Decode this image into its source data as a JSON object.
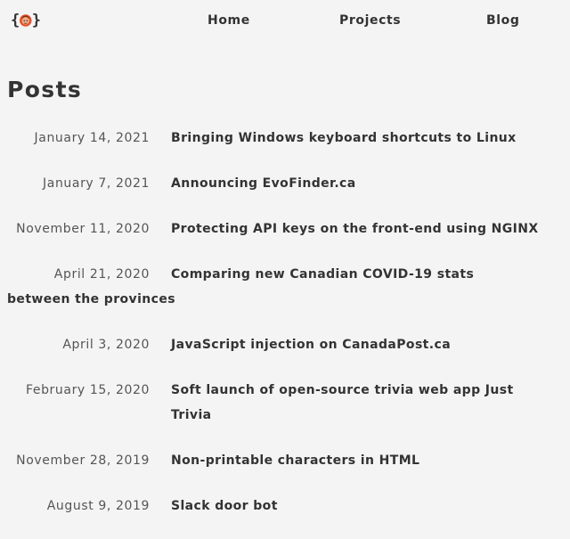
{
  "nav": {
    "logo_name": "avatar-logo",
    "items": [
      {
        "label": "Home"
      },
      {
        "label": "Projects"
      },
      {
        "label": "Blog"
      }
    ]
  },
  "main": {
    "title": "Posts",
    "posts": [
      {
        "date": "January 14, 2021",
        "title": "Bringing Windows keyboard shortcuts to Linux"
      },
      {
        "date": "January 7, 2021",
        "title": "Announcing EvoFinder.ca"
      },
      {
        "date": "November 11, 2020",
        "title": "Protecting API keys on the front-end using NGINX"
      },
      {
        "date": "April 21, 2020",
        "title": "Comparing new Canadian COVID-19 stats between the provinces"
      },
      {
        "date": "April 3, 2020",
        "title": "JavaScript injection on CanadaPost.ca"
      },
      {
        "date": "February 15, 2020",
        "title": "Soft launch of open-source trivia web app Just Trivia"
      },
      {
        "date": "November 28, 2019",
        "title": "Non-printable characters in HTML"
      },
      {
        "date": "August 9, 2019",
        "title": "Slack door bot"
      }
    ]
  },
  "colors": {
    "background": "#f4f4f4",
    "text": "#333333",
    "muted": "#555555",
    "avatar_orange": "#e8522a",
    "avatar_skin": "#f0b48a"
  }
}
